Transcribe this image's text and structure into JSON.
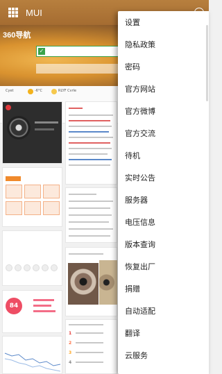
{
  "app": {
    "title": "MUI"
  },
  "browser": {
    "hero_logo": "360导航",
    "weather": {
      "city": "Cyet",
      "temp1": "-6°C",
      "temp2": "RLYF Cvrle"
    },
    "score": {
      "value": "84"
    }
  },
  "menu": {
    "items": [
      "设置",
      "隐私政策",
      "密码",
      "官方网站",
      "官方微博",
      "官方交流",
      "待机",
      "实时公告",
      "服务器",
      "电压信息",
      "版本查询",
      "恢复出厂",
      "捐赠",
      "自动适配",
      "翻译",
      "云服务"
    ]
  },
  "colors": {
    "appbar": "#a56c31",
    "accent_green": "#3aa34a",
    "accent_orange": "#f08a2c",
    "score_pink": "#ee4d64"
  }
}
